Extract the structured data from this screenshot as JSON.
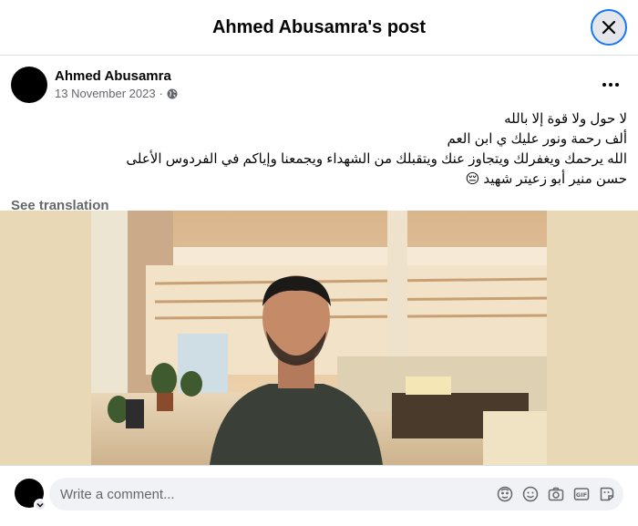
{
  "header": {
    "title": "Ahmed Abusamra's post"
  },
  "post": {
    "author": "Ahmed Abusamra",
    "date": "13 November 2023",
    "separator": "·",
    "privacy_icon": "globe-icon",
    "text_lines": [
      "لا حول ولا قوة إلا بالله",
      "ألف رحمة ونور عليك ي ابن العم",
      "الله يرحمك ويغفرلك ويتجاوز عنك ويتقبلك من الشهداء ويجمعنا وإياكم في الفردوس الأعلى",
      "حسن منير أبو زعيتر شهيد 😔"
    ],
    "see_translation": "See translation"
  },
  "comment": {
    "placeholder": "Write a comment...",
    "icons": [
      "avatar-sticker-icon",
      "emoji-icon",
      "camera-icon",
      "gif-icon",
      "sticker-icon"
    ]
  },
  "colors": {
    "accent": "#1877f2",
    "photo_bg": "#e9d8b6"
  }
}
